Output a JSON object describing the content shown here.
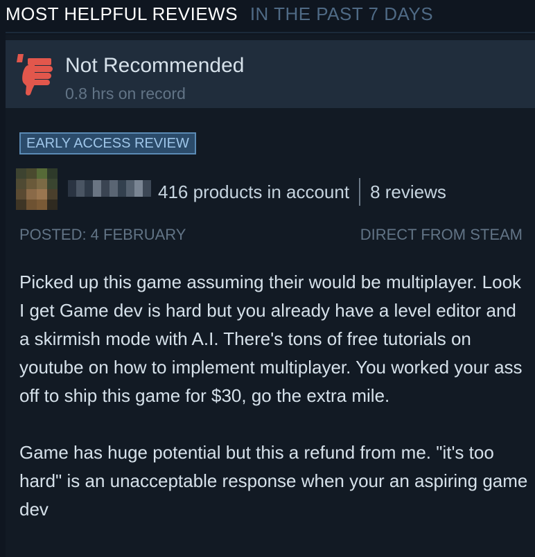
{
  "section": {
    "title": "MOST HELPFUL REVIEWS",
    "period": "IN THE PAST 7 DAYS"
  },
  "review": {
    "verdict": "Not Recommended",
    "verdict_icon": "thumbs-down-icon",
    "hours": "0.8 hrs on record",
    "badge": "EARLY ACCESS REVIEW",
    "reviewer": {
      "products": "416 products in account",
      "reviews": "8 reviews"
    },
    "posted": "POSTED: 4 FEBRUARY",
    "source": "DIRECT FROM STEAM",
    "body": [
      "Picked up this game assuming their would be multiplayer. Look I get Game dev is hard but you already have a level editor and a skirmish mode with A.I. There's tons of free tutorials on youtube on how to implement multiplayer. You worked your ass off to ship this game for $30, go the extra mile.",
      "Game has huge potential but this a refund from me. \"it's too hard\" is an unacceptable response when your an aspiring game dev"
    ]
  },
  "colors": {
    "background": "#0f1620",
    "vote_bar": "#202d3c",
    "thumb_down": "#e2574c",
    "badge_border": "#5b8bb5",
    "muted_text": "#627486"
  }
}
